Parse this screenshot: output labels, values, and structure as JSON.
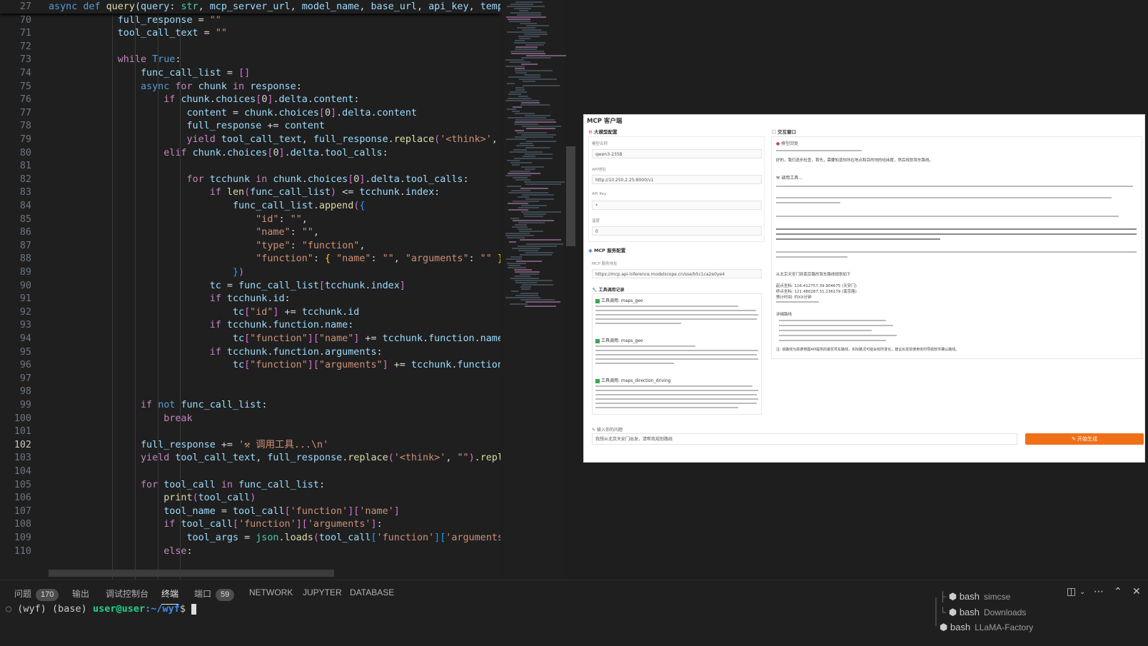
{
  "editor": {
    "lines": [
      {
        "n": "27",
        "html": "<span class=\"kw\">async</span> <span class=\"kw\">def</span> <span class=\"fn\">query</span>(<span class=\"vr\">query</span>: <span class=\"pm\">str</span>, <span class=\"vr\">mcp_server_url</span>, <span class=\"vr\">model_name</span>, <span class=\"vr\">base_url</span>, <span class=\"vr\">api_key</span>, <span class=\"vr\">tempera</span>"
      },
      {
        "n": "70",
        "html": "            <span class=\"vr\">full_response</span> = <span class=\"st\">\"\"</span>"
      },
      {
        "n": "71",
        "html": "            <span class=\"vr\">tool_call_text</span> = <span class=\"st\">\"\"</span>"
      },
      {
        "n": "72",
        "html": ""
      },
      {
        "n": "73",
        "html": "            <span class=\"kc\">while</span> <span class=\"kw\">True</span>:"
      },
      {
        "n": "74",
        "html": "                <span class=\"vr\">func_call_list</span> = <span class=\"br2\">[]</span>"
      },
      {
        "n": "75",
        "html": "                <span class=\"kw\">async</span> <span class=\"kc\">for</span> <span class=\"vr\">chunk</span> <span class=\"kc\">in</span> <span class=\"vr\">response</span>:"
      },
      {
        "n": "76",
        "html": "                    <span class=\"kc\">if</span> <span class=\"vr\">chunk</span>.<span class=\"vr\">choices</span><span class=\"br2\">[</span>0<span class=\"br2\">]</span>.<span class=\"vr\">delta</span>.<span class=\"vr\">content</span>:"
      },
      {
        "n": "77",
        "html": "                        <span class=\"vr\">content</span> = <span class=\"vr\">chunk</span>.<span class=\"vr\">choices</span><span class=\"br2\">[</span>0<span class=\"br2\">]</span>.<span class=\"vr\">delta</span>.<span class=\"vr\">content</span>"
      },
      {
        "n": "78",
        "html": "                        <span class=\"vr\">full_response</span> += <span class=\"vr\">content</span>"
      },
      {
        "n": "79",
        "html": "                        <span class=\"kc\">yield</span> <span class=\"vr\">tool_call_text</span>, <span class=\"vr\">full_response</span>.<span class=\"fn\">replace</span><span class=\"br2\">(</span><span class=\"st\">'&lt;think&gt;'</span>, <span class=\"st\">\"\"</span><span class=\"br2\">)</span>"
      },
      {
        "n": "80",
        "html": "                    <span class=\"kc\">elif</span> <span class=\"vr\">chunk</span>.<span class=\"vr\">choices</span><span class=\"br2\">[</span>0<span class=\"br2\">]</span>.<span class=\"vr\">delta</span>.<span class=\"vr\">tool_calls</span>:"
      },
      {
        "n": "81",
        "html": ""
      },
      {
        "n": "82",
        "html": "                        <span class=\"kc\">for</span> <span class=\"vr\">tcchunk</span> <span class=\"kc\">in</span> <span class=\"vr\">chunk</span>.<span class=\"vr\">choices</span><span class=\"br2\">[</span>0<span class=\"br2\">]</span>.<span class=\"vr\">delta</span>.<span class=\"vr\">tool_calls</span>:"
      },
      {
        "n": "83",
        "html": "                            <span class=\"kc\">if</span> <span class=\"fn\">len</span><span class=\"br2\">(</span><span class=\"vr\">func_call_list</span><span class=\"br2\">)</span> &lt;= <span class=\"vr\">tcchunk</span>.<span class=\"vr\">index</span>:"
      },
      {
        "n": "84",
        "html": "                                <span class=\"vr\">func_call_list</span>.<span class=\"fn\">append</span><span class=\"br2\">(</span><span class=\"br3\">{</span>"
      },
      {
        "n": "85",
        "html": "                                    <span class=\"st\">\"id\"</span>: <span class=\"st\">\"\"</span>,"
      },
      {
        "n": "86",
        "html": "                                    <span class=\"st\">\"name\"</span>: <span class=\"st\">\"\"</span>,"
      },
      {
        "n": "87",
        "html": "                                    <span class=\"st\">\"type\"</span>: <span class=\"st\">\"function\"</span>,"
      },
      {
        "n": "88",
        "html": "                                    <span class=\"st\">\"function\"</span>: <span class=\"br1\">{</span> <span class=\"st\">\"name\"</span>: <span class=\"st\">\"\"</span>, <span class=\"st\">\"arguments\"</span>: <span class=\"st\">\"\"</span> <span class=\"br1\">}</span>"
      },
      {
        "n": "89",
        "html": "                                <span class=\"br3\">}</span><span class=\"br2\">)</span>"
      },
      {
        "n": "90",
        "html": "                            <span class=\"vr\">tc</span> = <span class=\"vr\">func_call_list</span><span class=\"br2\">[</span><span class=\"vr\">tcchunk</span>.<span class=\"vr\">index</span><span class=\"br2\">]</span>"
      },
      {
        "n": "91",
        "html": "                            <span class=\"kc\">if</span> <span class=\"vr\">tcchunk</span>.<span class=\"vr\">id</span>:"
      },
      {
        "n": "92",
        "html": "                                <span class=\"vr\">tc</span><span class=\"br2\">[</span><span class=\"st\">\"id\"</span><span class=\"br2\">]</span> += <span class=\"vr\">tcchunk</span>.<span class=\"vr\">id</span>"
      },
      {
        "n": "93",
        "html": "                            <span class=\"kc\">if</span> <span class=\"vr\">tcchunk</span>.<span class=\"vr\">function</span>.<span class=\"vr\">name</span>:"
      },
      {
        "n": "94",
        "html": "                                <span class=\"vr\">tc</span><span class=\"br2\">[</span><span class=\"st\">\"function\"</span><span class=\"br2\">][</span><span class=\"st\">\"name\"</span><span class=\"br2\">]</span> += <span class=\"vr\">tcchunk</span>.<span class=\"vr\">function</span>.<span class=\"vr\">name</span>"
      },
      {
        "n": "95",
        "html": "                            <span class=\"kc\">if</span> <span class=\"vr\">tcchunk</span>.<span class=\"vr\">function</span>.<span class=\"vr\">arguments</span>:"
      },
      {
        "n": "96",
        "html": "                                <span class=\"vr\">tc</span><span class=\"br2\">[</span><span class=\"st\">\"function\"</span><span class=\"br2\">][</span><span class=\"st\">\"arguments\"</span><span class=\"br2\">]</span> += <span class=\"vr\">tcchunk</span>.<span class=\"vr\">function</span>.<span class=\"vr\">ar</span>"
      },
      {
        "n": "97",
        "html": ""
      },
      {
        "n": "98",
        "html": ""
      },
      {
        "n": "99",
        "html": "                <span class=\"kc\">if</span> <span class=\"kw\">not</span> <span class=\"vr\">func_call_list</span>:"
      },
      {
        "n": "100",
        "html": "                    <span class=\"kc\">break</span>"
      },
      {
        "n": "101",
        "html": ""
      },
      {
        "n": "102",
        "html": "                <span class=\"vr\">full_response</span> += <span class=\"st\">'⚒ 调用工具...\\n'</span>"
      },
      {
        "n": "103",
        "html": "                <span class=\"kc\">yield</span> <span class=\"vr\">tool_call_text</span>, <span class=\"vr\">full_response</span>.<span class=\"fn\">replace</span><span class=\"br2\">(</span><span class=\"st\">'&lt;think&gt;'</span>, <span class=\"st\">\"\"</span><span class=\"br2\">)</span>.<span class=\"fn\">replace</span>"
      },
      {
        "n": "104",
        "html": ""
      },
      {
        "n": "105",
        "html": "                <span class=\"kc\">for</span> <span class=\"vr\">tool_call</span> <span class=\"kc\">in</span> <span class=\"vr\">func_call_list</span>:"
      },
      {
        "n": "106",
        "html": "                    <span class=\"fn\">print</span><span class=\"br2\">(</span><span class=\"vr\">tool_call</span><span class=\"br2\">)</span>"
      },
      {
        "n": "107",
        "html": "                    <span class=\"vr\">tool_name</span> = <span class=\"vr\">tool_call</span><span class=\"br2\">[</span><span class=\"st\">'function'</span><span class=\"br2\">][</span><span class=\"st\">'name'</span><span class=\"br2\">]</span>"
      },
      {
        "n": "108",
        "html": "                    <span class=\"kc\">if</span> <span class=\"vr\">tool_call</span><span class=\"br2\">[</span><span class=\"st\">'function'</span><span class=\"br2\">][</span><span class=\"st\">'arguments'</span><span class=\"br2\">]</span>:"
      },
      {
        "n": "109",
        "html": "                        <span class=\"vr\">tool_args</span> = <span class=\"pm\">json</span>.<span class=\"fn\">loads</span><span class=\"br2\">(</span><span class=\"vr\">tool_call</span><span class=\"br3\">[</span><span class=\"st\">'function'</span><span class=\"br3\">][</span><span class=\"st\">'arguments'</span><span class=\"br3\">]</span><span class=\"br2\">)</span>"
      },
      {
        "n": "110",
        "html": "                    <span class=\"kc\">else</span>:"
      }
    ],
    "current_line": "102"
  },
  "mcp_window": {
    "title": "MCP 客户端",
    "llm_section_title": "大模型配置",
    "chat_section_title": "交互窗口",
    "model_name_label": "模型名称",
    "model_name_value": "qwen3-235B",
    "api_address_label": "API地址",
    "api_address_value": "http://10.250.2.25:8000/v1",
    "api_key_label": "API Key",
    "api_key_value": "*",
    "temperature_label": "温度",
    "temperature_value": "0",
    "mcp_section_title": "MCP 服务配置",
    "mcp_address_label": "MCP 服务地址",
    "mcp_address_value": "https://mcp.api-inference.modelscope.cn/sse/b5c1ca2e0ye4",
    "tool_log_title": "工具调用记录",
    "tool_call_1": "工具调用: maps_geo",
    "tool_call_2": "工具调用: maps_geo",
    "tool_call_3": "工具调用: maps_direction_driving",
    "reply_label": "模型回复",
    "reply_intro": "好的，我们逐步检查，首先，需要知道你所在地点和目的地的经纬度，然后规划驾车路线。",
    "reply_step_heading": "调用工具...",
    "reply_summary": "从北京天安门到南京路的驾车路线规划如下",
    "reply_distance": "起点坐标: 116.412757,39.904675 (天安门)",
    "reply_dest": "终点坐标: 121.480287,31.236179 (南京路)",
    "reply_time": "预计时间: 约XX分钟",
    "reply_tips_heading": "详细路线",
    "reply_note": "注: 该路线为高德地图API提供的最优驾车路线，实际路况可能会有所变化，建议出发前使用实时导航软件确认路线。",
    "input_label": "输入你的问题",
    "input_value": "我想从北京天安门出发，请帮我规划路线",
    "generate_button": "开始生成"
  },
  "panel": {
    "tabs": [
      {
        "label": "问题",
        "badge": "170"
      },
      {
        "label": "输出",
        "badge": ""
      },
      {
        "label": "调试控制台",
        "badge": ""
      },
      {
        "label": "终端",
        "badge": "",
        "active": true
      },
      {
        "label": "端口",
        "badge": "59"
      },
      {
        "label": "NETWORK",
        "badge": ""
      },
      {
        "label": "JUPYTER",
        "badge": ""
      },
      {
        "label": "DATABASE",
        "badge": ""
      }
    ],
    "prompt_env": "(wyf) (base) ",
    "prompt_user": "user@user",
    "prompt_path": ":~/wyf",
    "prompt_symbol": "$",
    "terminals": [
      {
        "shell": "bash",
        "cwd": "simcse"
      },
      {
        "shell": "bash",
        "cwd": "Downloads"
      },
      {
        "shell": "bash",
        "cwd": "LLaMA-Factory"
      }
    ]
  },
  "colors": {
    "editor_bg": "#1f1f1f",
    "keyword": "#569cd6",
    "control": "#c586c0",
    "function": "#dcdcaa",
    "string": "#ce9178",
    "variable": "#9cdcfe",
    "generate_button": "#f07018"
  }
}
